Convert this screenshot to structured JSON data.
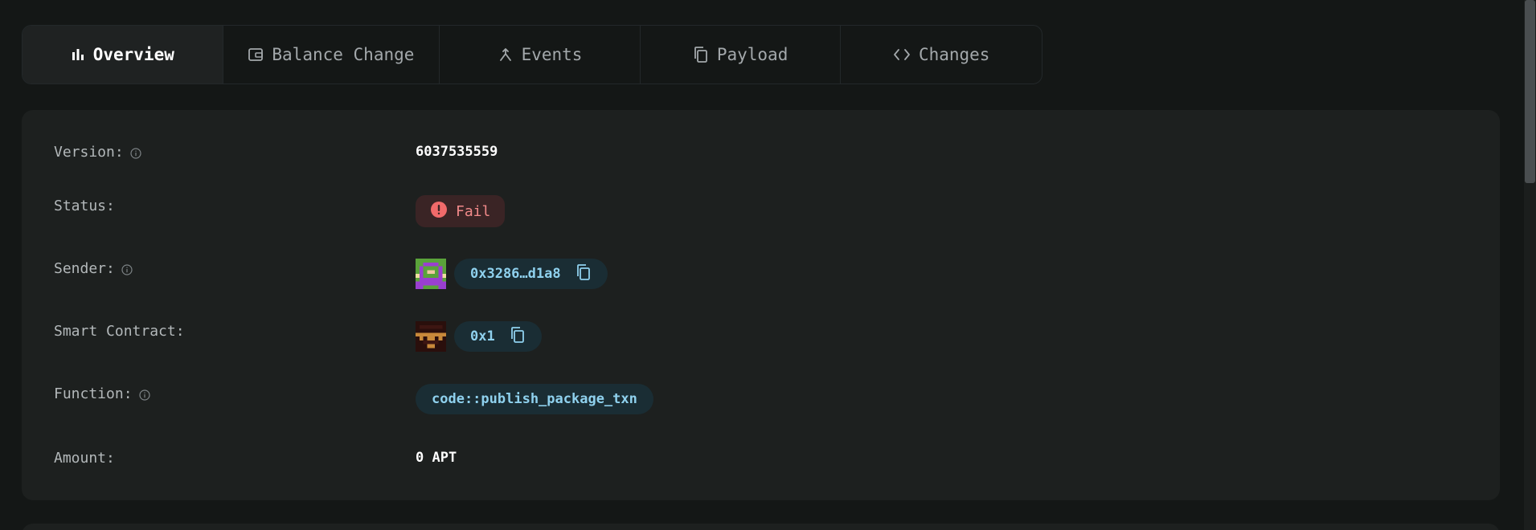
{
  "tabs": [
    {
      "label": "Overview",
      "icon": "bar-chart-icon",
      "active": true
    },
    {
      "label": "Balance Change",
      "icon": "wallet-icon",
      "active": false
    },
    {
      "label": "Events",
      "icon": "merge-icon",
      "active": false
    },
    {
      "label": "Payload",
      "icon": "copy-icon",
      "active": false
    },
    {
      "label": "Changes",
      "icon": "code-icon",
      "active": false
    }
  ],
  "overview": {
    "version": {
      "label": "Version:",
      "value": "6037535559"
    },
    "status": {
      "label": "Status:",
      "value": "Fail",
      "color": "#f28a8a"
    },
    "sender": {
      "label": "Sender:",
      "value": "0x3286…d1a8"
    },
    "smart_contract": {
      "label": "Smart Contract:",
      "value": "0x1"
    },
    "function": {
      "label": "Function:",
      "value": "code::publish_package_txn"
    },
    "amount": {
      "label": "Amount:",
      "value": "0 APT"
    }
  },
  "colors": {
    "background": "#141716",
    "card": "#1d201f",
    "chip_text": "#8fd1ee",
    "fail_text": "#f28a8a"
  }
}
